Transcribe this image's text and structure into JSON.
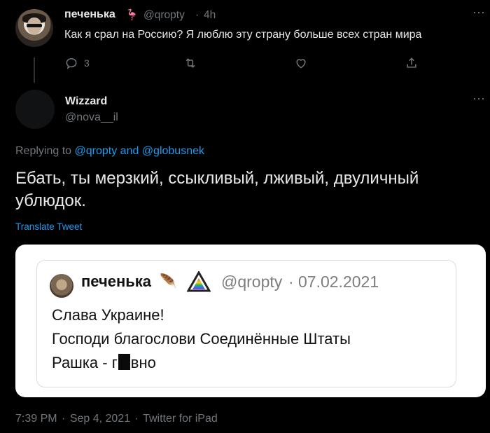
{
  "parent_tweet": {
    "display_name": "печенька",
    "name_emoji": "🦩",
    "handle": "@qropty",
    "separator": "·",
    "time": "4h",
    "text": "Как я срал на Россию? Я люблю эту страну больше всех стран мира",
    "reply_count": "3",
    "icons": {
      "reply": "reply-icon",
      "retweet": "retweet-icon",
      "like": "like-icon",
      "share": "share-icon",
      "more": "more-icon"
    }
  },
  "main_tweet": {
    "display_name": "Wizzard",
    "handle": "@nova__il",
    "replying_prefix": "Replying to ",
    "replying_user1": "@qropty",
    "replying_and": " and ",
    "replying_user2": "@globusnek",
    "text": "Ебать, ты мерзкий, ссыкливый, лживый, двуличный ублюдок.",
    "translate_label": "Translate Tweet",
    "footer": {
      "time": "7:39 PM",
      "sep": "·",
      "date": "Sep 4, 2021",
      "source": "Twitter for iPad"
    }
  },
  "embedded_screenshot": {
    "display_name": "печенька",
    "name_emoji": "🪶",
    "handle": "@qropty",
    "separator": "·",
    "date": "07.02.2021",
    "line1": "Слава Украине!",
    "line2": "Господи благослови Соединённые Штаты",
    "line3_before": "Рашка - г",
    "line3_after": "вно",
    "colors": {
      "triangle": [
        "#e23b3b",
        "#f59b2b",
        "#f5d42b",
        "#3bb54a",
        "#2b7de2",
        "#8b3be2"
      ]
    }
  },
  "colors": {
    "background": "#000000",
    "accent": "#1d9bf0",
    "muted": "#71767b",
    "text": "#e7e9ea"
  }
}
